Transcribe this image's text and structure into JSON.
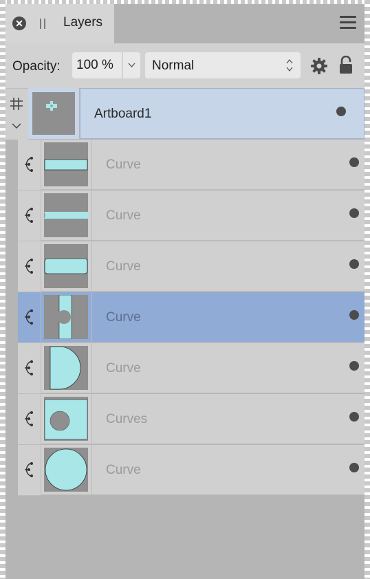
{
  "panel": {
    "tab_title": "Layers",
    "close_icon": "close-icon",
    "menu_icon": "hamburger-menu-icon"
  },
  "toolbar": {
    "opacity_label": "Opacity:",
    "opacity_value": "100 %",
    "blend_mode": "Normal",
    "settings_icon": "gear-icon",
    "lock_icon": "lock-icon"
  },
  "artboard": {
    "name": "Artboard1",
    "icon": "artboard-grid-icon",
    "expanded": true
  },
  "layers": [
    {
      "name": "Curve",
      "thumb": "bar-wide",
      "selected": false,
      "visible": true
    },
    {
      "name": "Curve",
      "thumb": "bar-thin",
      "selected": false,
      "visible": true
    },
    {
      "name": "Curve",
      "thumb": "bar-rounded",
      "selected": false,
      "visible": true
    },
    {
      "name": "Curve",
      "thumb": "vertical-bar-notch",
      "selected": true,
      "visible": true
    },
    {
      "name": "Curve",
      "thumb": "half-circle",
      "selected": false,
      "visible": true
    },
    {
      "name": "Curves",
      "thumb": "square-with-circle",
      "selected": false,
      "visible": true
    },
    {
      "name": "Curve",
      "thumb": "circle",
      "selected": false,
      "visible": true
    }
  ],
  "colors": {
    "accent_selected": "#8fabd6",
    "artboard_highlight": "#c7d5e8",
    "shape_fill": "#a8e6e8",
    "thumb_background": "#8f8f8f"
  }
}
